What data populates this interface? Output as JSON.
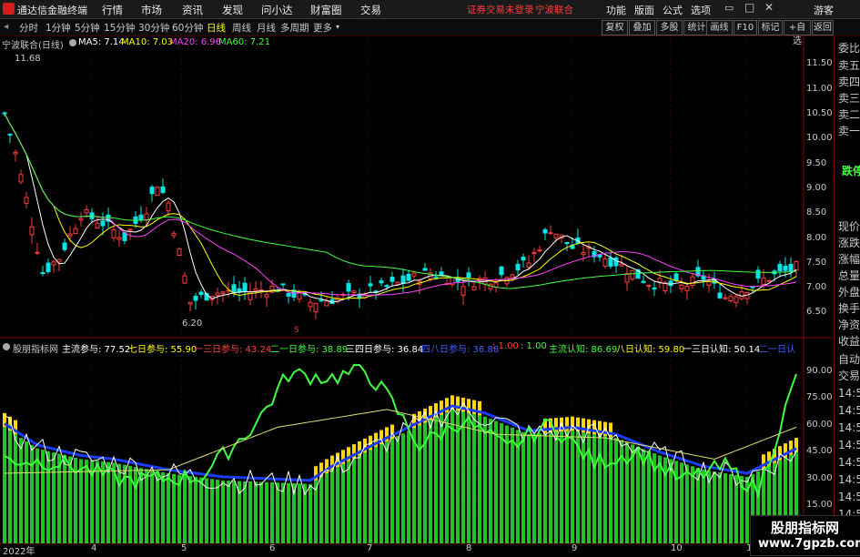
{
  "titlebar": {
    "app_name": "通达信金融终端",
    "menu": [
      "行情",
      "市场",
      "资讯",
      "发现",
      "问小达",
      "财富圈",
      "交易"
    ],
    "warning": "证券交易未登录",
    "stock_name": "宁波联合",
    "right_menu": [
      "功能",
      "版面",
      "公式",
      "选项"
    ],
    "guest": "游客"
  },
  "toolbar": {
    "periods": [
      "分时",
      "1分钟",
      "5分钟",
      "15分钟",
      "30分钟",
      "60分钟",
      "日线",
      "周线",
      "月线",
      "多周期",
      "更多"
    ],
    "active": "日线",
    "right_buttons": [
      "复权",
      "叠加",
      "多股",
      "统计",
      "画线",
      "F10",
      "标记",
      "+自选",
      "返回"
    ]
  },
  "main_chart": {
    "title": "宁波联合(日线)",
    "ma_labels": [
      {
        "text": "MA5: 7.14",
        "color": "#ffffff"
      },
      {
        "text": "MA10: 7.03",
        "color": "#ffff00"
      },
      {
        "text": "MA20: 6.96",
        "color": "#ff40ff"
      },
      {
        "text": "MA60: 7.21",
        "color": "#40ff40"
      }
    ],
    "high_marker": "11.68",
    "low_marker": "6.20",
    "y_ticks": [
      "11.50",
      "11.00",
      "10.50",
      "10.00",
      "9.50",
      "9.00",
      "8.50",
      "8.00",
      "7.50",
      "7.00",
      "6.50"
    ],
    "event_marker": "S"
  },
  "sub_chart": {
    "title": "股朋指标网",
    "labels": [
      {
        "text": "主流参与: 77.52",
        "color": "#ffffff"
      },
      {
        "text": "七日参与: 55.90",
        "color": "#ffff00"
      },
      {
        "text": "一三日参与: 43.24",
        "color": "#ff4040"
      },
      {
        "text": "二一日参与: 38.89",
        "color": "#40ff40"
      },
      {
        "text": "三四日参与: 36.84",
        "color": "#ffffff"
      },
      {
        "text": "四八日参与: 36.88",
        "color": "#4060ff"
      },
      {
        "text": ": 1.00",
        "color": "#ff4040"
      },
      {
        "text": ": 1.00",
        "color": "#40ff40"
      },
      {
        "text": "主流认知: 86.69",
        "color": "#40ff40"
      },
      {
        "text": "八日认知: 59.80",
        "color": "#ffff00"
      },
      {
        "text": "一三日认知: 50.14",
        "color": "#ffffff"
      },
      {
        "text": "二一日认",
        "color": "#4060ff"
      }
    ],
    "y_ticks": [
      "90.00",
      "75.00",
      "60.00",
      "45.00",
      "30.00",
      "15.00"
    ]
  },
  "x_axis": [
    "2022年",
    "4",
    "5",
    "6",
    "7",
    "8",
    "9",
    "10",
    "1"
  ],
  "right_panel": {
    "top": [
      "委比",
      "卖五",
      "卖四",
      "卖三",
      "卖二",
      "卖一"
    ],
    "middle": "跌停",
    "lower": [
      "现价",
      "涨跌",
      "涨幅",
      "总量",
      "外盘",
      "换手",
      "净资",
      "收益"
    ],
    "bottom": [
      "自动",
      "交易"
    ],
    "times": [
      "14:5",
      "14:5",
      "14:5",
      "14:5",
      "14:5",
      "14:5",
      "14:5",
      "14:5"
    ]
  },
  "watermark": {
    "line1": "股朋指标网",
    "line2": "www.7gpzb.com"
  }
}
